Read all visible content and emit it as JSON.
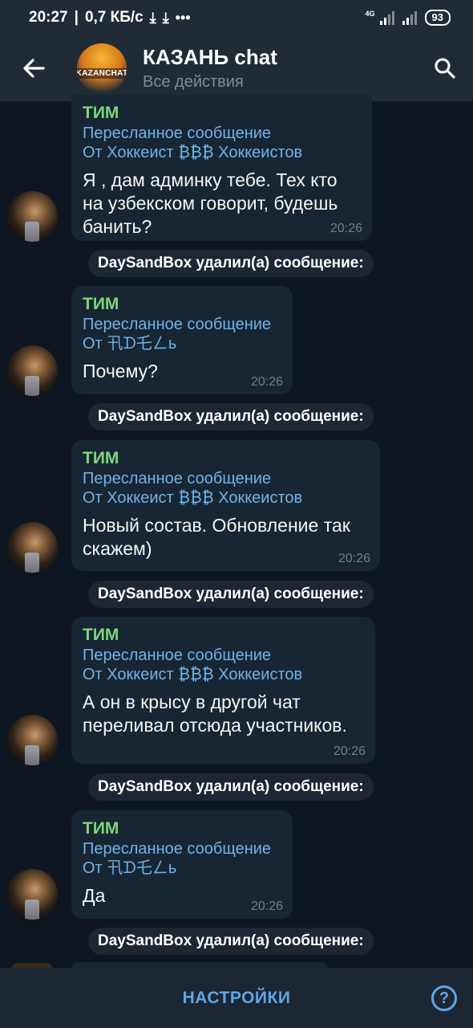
{
  "status_bar": {
    "time": "20:27",
    "speed": "0,7 КБ/с",
    "network": "4G",
    "battery": "93"
  },
  "header": {
    "title": "КАЗАНЬ chat",
    "subtitle": "Все действия",
    "avatar_text": "KAZANCHAT"
  },
  "messages": [
    {
      "sender": "ТИМ",
      "fwd_label": "Пересланное сообщение",
      "fwd_from": "От Хоккеист ₿₿₿ Хоккеистов",
      "text_lines": [
        "Я , дам админку тебе. Тех кто",
        "на узбекском говорит, будешь",
        "банить?"
      ],
      "time": "20:26"
    },
    {
      "sender": "ТИМ",
      "fwd_label": "Пересланное сообщение",
      "fwd_from": "От 卂ᗪ乇ㄥь",
      "text_lines": [
        "Почему?"
      ],
      "time": "20:26"
    },
    {
      "sender": "ТИМ",
      "fwd_label": "Пересланное сообщение",
      "fwd_from": "От Хоккеист ₿₿₿ Хоккеистов",
      "text_lines": [
        "Новый состав. Обновление так",
        "скажем)"
      ],
      "time": "20:26"
    },
    {
      "sender": "ТИМ",
      "fwd_label": "Пересланное сообщение",
      "fwd_from": "От Хоккеист ₿₿₿ Хоккеистов",
      "text_lines": [
        "А он в крысу в другой чат",
        "переливал отсюда участников."
      ],
      "time": "20:26"
    },
    {
      "sender": "ТИМ",
      "fwd_label": "Пересланное сообщение",
      "fwd_from": "От 卂ᗪ乇ㄥь",
      "text_lines": [
        "Да"
      ],
      "time": "20:26"
    }
  ],
  "service_text": "DaySandBox удалил(а) сообщение:",
  "bottom": {
    "settings_label": "НАСТРОЙКИ",
    "help_label": "?"
  }
}
